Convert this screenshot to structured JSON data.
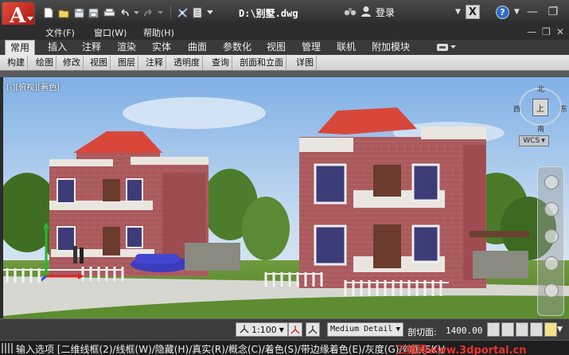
{
  "window": {
    "title": "D:\\别墅.dwg",
    "login_label": "登录",
    "logo_letter": "A",
    "logo_small": "A"
  },
  "menu": {
    "items": [
      "文件(F)",
      "窗口(W)",
      "帮助(H)"
    ]
  },
  "ribbon": {
    "tabs": [
      "常用",
      "插入",
      "注释",
      "渲染",
      "实体",
      "曲面",
      "参数化",
      "视图",
      "管理",
      "联机",
      "附加模块"
    ],
    "active_tab": "常用",
    "panels": [
      "构建",
      "绘图",
      "修改",
      "视图",
      "图层",
      "注释",
      "透明度",
      "查询",
      "剖面和立面",
      "详图"
    ]
  },
  "viewport": {
    "label": "[-][俯视][着色]",
    "viewcube_top": "北",
    "viewcube_bottom": "南",
    "viewcube_left": "西",
    "viewcube_right": "东",
    "viewcube_face": "上",
    "wcs_label": "WCS"
  },
  "statusbar": {
    "scale": "1:100",
    "detail": "Medium Detail",
    "section_label": "剖切面:",
    "section_value": "1400.00"
  },
  "command": {
    "text": "输入选项 [二维线框(2)/线框(W)/隐藏(H)/真实(R)/概念(C)/着色(S)/带边缘着色(E)/灰度(G)/勾画(SK)/",
    "watermark": "三维网www.3dportal.cn"
  },
  "colors": {
    "accent_red": "#c0261f",
    "sky_top": "#8fb8e8",
    "brick": "#a8575a",
    "roof": "#d9473b"
  }
}
